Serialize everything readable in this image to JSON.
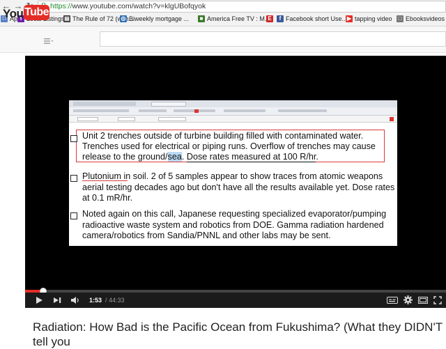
{
  "browser": {
    "url_scheme": "https://",
    "url_rest": "www.youtube.com/watch?v=klgUBofqyok",
    "bookmarks": [
      {
        "label": "Apps",
        "icon": "apps-grid-icon",
        "color": "#5a7fc6"
      },
      {
        "label": "Local Listings",
        "icon": "yahoo-icon",
        "color": "#6b1fa8"
      },
      {
        "label": "The Rule of 72 (with...",
        "icon": "bookmark-page-icon",
        "color": "#3a3a3a"
      },
      {
        "label": "Biweekly mortgage ...",
        "icon": "globe-icon",
        "color": "#2e6fb3"
      },
      {
        "label": "America Free TV : M...",
        "icon": "tv-icon",
        "color": "#3c7a2c"
      },
      {
        "label": "",
        "icon": "e-logo-icon",
        "color": "#d0262a"
      },
      {
        "label": "Facebook short Use...",
        "icon": "facebook-icon",
        "color": "#3b5998"
      },
      {
        "label": "tapping video",
        "icon": "youtube-icon",
        "color": "#e52d27"
      },
      {
        "label": "Ebooksvideos",
        "icon": "document-icon",
        "color": "#777777"
      }
    ]
  },
  "youtube": {
    "logo_you": "You",
    "logo_tube": "Tube",
    "accent": "#e52d27"
  },
  "slide": {
    "items": [
      {
        "lines": [
          "Unit 2 trenches outside of turbine building filled with contaminated water.",
          "Trenches used for electrical or piping runs.  Overflow of trenches may cause"
        ],
        "line3_part1": "release to the ground/",
        "line3_highlight": "sea",
        "line3_part2": ".  ",
        "line3_underlined": "Dose rates measured at 100 R/hr",
        "line3_end": "."
      },
      {
        "lead": "Plutonium in soil.",
        "line1_rest": "  2 of 5 samples appear to show traces from atomic weapons",
        "lines": [
          "aerial testing decades ago but don't have all the results available yet.  Dose rates",
          "at 0.1 mR/hr."
        ]
      },
      {
        "lines": [
          "Noted again on this call, Japanese requesting specialized evaporator/pumping",
          "radioactive waste system and robotics from DOE.  Gamma radiation hardened",
          "camera/robotics from Sandia/PNNL and other labs may be sent."
        ]
      }
    ]
  },
  "player": {
    "current_time": "1:53",
    "total_time": "/ 44:33",
    "progress": 0.043
  },
  "video_title": "Radiation: How Bad is the Pacific Ocean from Fukushima? (What they DIDN'T tell you"
}
